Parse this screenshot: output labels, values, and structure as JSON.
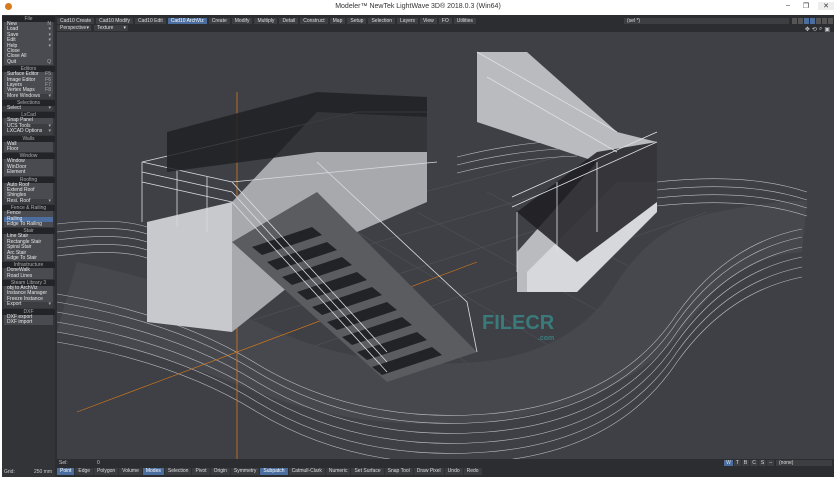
{
  "window": {
    "title": "Modeler™ NewTek LightWave 3D® 2018.0.3 (Win64)",
    "minimize": "–",
    "maximize": "❐",
    "close": "✕"
  },
  "tabs": [
    "Cad10 Create",
    "Cad10 Modify",
    "Cad10 Edit",
    "Cad10 ArchViz",
    "Create",
    "Modify",
    "Multiply",
    "Detail",
    "Construct",
    "Map",
    "Setup",
    "Selection",
    "Layers",
    "View",
    "FO",
    "Utilities"
  ],
  "active_tab": "Cad10 ArchViz",
  "viewport": {
    "view": "Perspective",
    "shading": "Texture",
    "layer_select": "(sel *)",
    "watermark": "FILECR",
    "watermark_sub": ".com"
  },
  "sidebar": [
    {
      "header": "File",
      "items": [
        {
          "label": "New",
          "key": "N"
        },
        {
          "label": "Load",
          "key": "▾"
        },
        {
          "label": "Save",
          "key": "▾"
        },
        {
          "label": "Edit",
          "key": "▾"
        },
        {
          "label": "Help",
          "key": "▾"
        },
        {
          "label": "Close",
          "key": ""
        },
        {
          "label": "Close All",
          "key": ""
        },
        {
          "label": "Quit",
          "key": "Q"
        }
      ]
    },
    {
      "header": "Editors",
      "items": [
        {
          "label": "Surface Editor",
          "key": "F5"
        },
        {
          "label": "Image Editor",
          "key": "F6"
        },
        {
          "label": "Layers",
          "key": "F7"
        },
        {
          "label": "Vertex Maps",
          "key": "F8"
        },
        {
          "label": "More Windows",
          "key": "▾",
          "dd": true
        }
      ]
    },
    {
      "header": "Selections",
      "items": [
        {
          "label": "Select",
          "key": "▾",
          "dd": true
        }
      ]
    },
    {
      "header": "LxCad",
      "items": [
        {
          "label": "Snap Panel",
          "key": ""
        },
        {
          "label": "UCS Tools",
          "key": "▾",
          "dd": true
        },
        {
          "label": "LXCAD Options",
          "key": "▾",
          "dd": true
        }
      ]
    },
    {
      "header": "Walls",
      "items": [
        {
          "label": "Wall",
          "key": ""
        },
        {
          "label": "Floor",
          "key": ""
        }
      ]
    },
    {
      "header": "Window",
      "items": [
        {
          "label": "Window",
          "key": ""
        },
        {
          "label": "WinDoor",
          "key": ""
        },
        {
          "label": "Element",
          "key": ""
        }
      ]
    },
    {
      "header": "Roofing",
      "items": [
        {
          "label": "Auto Roof",
          "key": ""
        },
        {
          "label": "Extend Roof",
          "key": ""
        },
        {
          "label": "Shingles",
          "key": ""
        },
        {
          "label": "Resi. Roof",
          "key": "▾",
          "dd": true
        }
      ]
    },
    {
      "header": "Fence & Railing",
      "items": [
        {
          "label": "Fence",
          "key": ""
        },
        {
          "label": "Railing",
          "key": "",
          "selected": true
        },
        {
          "label": "Edge To Railing",
          "key": ""
        }
      ]
    },
    {
      "header": "Stair",
      "items": [
        {
          "label": "Line Stair",
          "key": ""
        },
        {
          "label": "Rectangle Stair",
          "key": ""
        },
        {
          "label": "Spiral Stair",
          "key": ""
        },
        {
          "label": "Arc Stair",
          "key": ""
        },
        {
          "label": "Edge To Stair",
          "key": ""
        }
      ]
    },
    {
      "header": "Infrastructure",
      "items": [
        {
          "label": "DoneWalk",
          "key": ""
        },
        {
          "label": "Road Lines",
          "key": ""
        }
      ]
    },
    {
      "header": "Steam Library 3",
      "items": [
        {
          "label": "obj to ArchViz",
          "key": ""
        },
        {
          "label": "Instance Manager",
          "key": ""
        },
        {
          "label": "Freeze Instance",
          "key": ""
        },
        {
          "label": "Export",
          "key": "▾",
          "dd": true
        }
      ]
    },
    {
      "header": "DXF",
      "items": [
        {
          "label": "DXF export",
          "key": ""
        },
        {
          "label": "DXF import",
          "key": ""
        }
      ]
    }
  ],
  "grid": {
    "label": "Grid:",
    "value": "250 mm"
  },
  "status": {
    "sel_label": "Sel:",
    "sel_value": "0"
  },
  "view_buttons": [
    "W",
    "T",
    "B",
    "C",
    "S",
    "–"
  ],
  "active_view_button": "W",
  "morph": "(none)",
  "modes": [
    "Point",
    "Edge",
    "Polygon",
    "Volume",
    "Modes",
    "Selection",
    "Pivot",
    "Origin",
    "Symmetry",
    "Subpatch",
    "Catmull-Clark",
    "Numeric",
    "Set Surface",
    "Snap Tool",
    "Draw Pixel",
    "Undo",
    "Redo"
  ],
  "active_modes": [
    "Point",
    "Modes",
    "Subpatch"
  ],
  "colors": {
    "accent": "#4b6e9f",
    "panel": "#333438",
    "viewport": "#3e4045",
    "axis": "#d67a1c"
  }
}
